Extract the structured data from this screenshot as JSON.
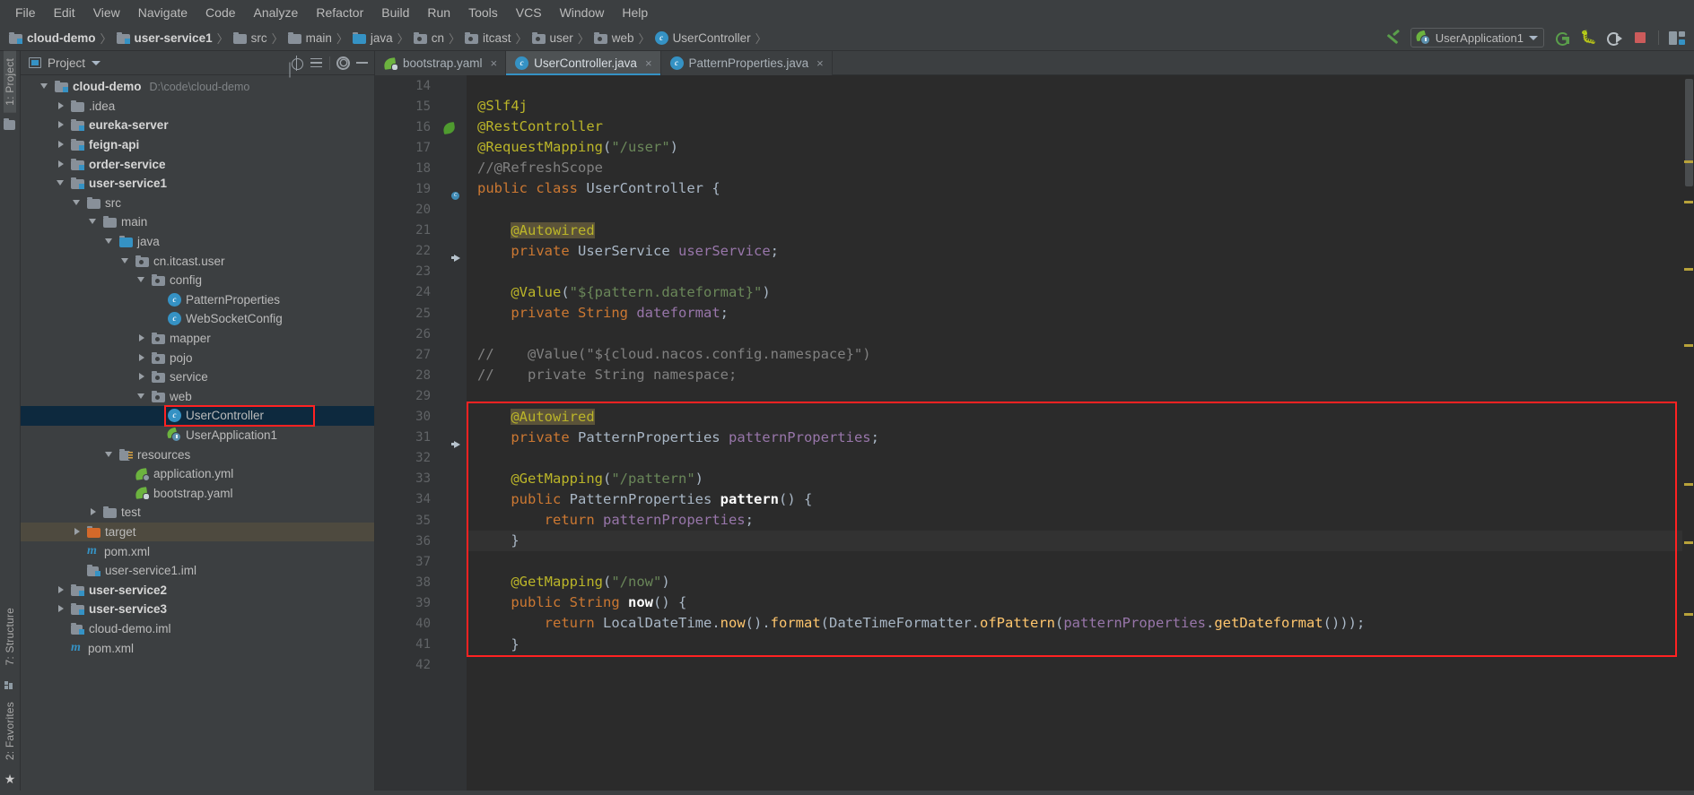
{
  "menubar": {
    "items": [
      "File",
      "Edit",
      "View",
      "Navigate",
      "Code",
      "Analyze",
      "Refactor",
      "Build",
      "Run",
      "Tools",
      "VCS",
      "Window",
      "Help"
    ]
  },
  "breadcrumb": {
    "items": [
      {
        "label": "cloud-demo",
        "icon": "module-icon",
        "bold": true
      },
      {
        "label": "user-service1",
        "icon": "module-icon",
        "bold": true
      },
      {
        "label": "src",
        "icon": "folder-icon",
        "bold": false
      },
      {
        "label": "main",
        "icon": "folder-icon",
        "bold": false
      },
      {
        "label": "java",
        "icon": "source-folder-icon",
        "bold": false
      },
      {
        "label": "cn",
        "icon": "package-icon",
        "bold": false
      },
      {
        "label": "itcast",
        "icon": "package-icon",
        "bold": false
      },
      {
        "label": "user",
        "icon": "package-icon",
        "bold": false
      },
      {
        "label": "web",
        "icon": "package-icon",
        "bold": false
      },
      {
        "label": "UserController",
        "icon": "class-icon",
        "bold": false
      }
    ],
    "separator": "〉"
  },
  "toolbar": {
    "build_icon": "hammer-icon",
    "run_config": "UserApplication1",
    "run_icon": "run-icon",
    "debug_icon": "debug-icon",
    "rerun_icon": "run-with-coverage-icon",
    "stop_icon": "stop-icon",
    "layout_icon": "layout-icon"
  },
  "leftstrip": {
    "project_tab": "1: Project",
    "structure_tab": "7: Structure",
    "favorites_tab": "2: Favorites"
  },
  "project_panel": {
    "title": "Project",
    "icons": [
      "scroll-from-source-icon",
      "collapse-all-icon",
      "gear-icon",
      "hide-icon"
    ],
    "tree": [
      {
        "depth": 0,
        "label": "cloud-demo",
        "path": "D:\\code\\cloud-demo",
        "icon": "module-icon",
        "twist": "down",
        "bold": true
      },
      {
        "depth": 1,
        "label": ".idea",
        "icon": "folder-icon",
        "twist": "right",
        "bold": false
      },
      {
        "depth": 1,
        "label": "eureka-server",
        "icon": "module-icon",
        "twist": "right",
        "bold": true
      },
      {
        "depth": 1,
        "label": "feign-api",
        "icon": "module-icon",
        "twist": "right",
        "bold": true
      },
      {
        "depth": 1,
        "label": "order-service",
        "icon": "module-icon",
        "twist": "right",
        "bold": true
      },
      {
        "depth": 1,
        "label": "user-service1",
        "icon": "module-icon",
        "twist": "down",
        "bold": true
      },
      {
        "depth": 2,
        "label": "src",
        "icon": "folder-icon",
        "twist": "down",
        "bold": false
      },
      {
        "depth": 3,
        "label": "main",
        "icon": "folder-icon",
        "twist": "down",
        "bold": false
      },
      {
        "depth": 4,
        "label": "java",
        "icon": "source-folder-icon",
        "twist": "down",
        "bold": false
      },
      {
        "depth": 5,
        "label": "cn.itcast.user",
        "icon": "package-icon",
        "twist": "down",
        "bold": false
      },
      {
        "depth": 6,
        "label": "config",
        "icon": "package-icon",
        "twist": "down",
        "bold": false
      },
      {
        "depth": 7,
        "label": "PatternProperties",
        "icon": "class-icon",
        "twist": "none",
        "bold": false
      },
      {
        "depth": 7,
        "label": "WebSocketConfig",
        "icon": "class-icon",
        "twist": "none",
        "bold": false
      },
      {
        "depth": 6,
        "label": "mapper",
        "icon": "package-icon",
        "twist": "right",
        "bold": false
      },
      {
        "depth": 6,
        "label": "pojo",
        "icon": "package-icon",
        "twist": "right",
        "bold": false
      },
      {
        "depth": 6,
        "label": "service",
        "icon": "package-icon",
        "twist": "right",
        "bold": false
      },
      {
        "depth": 6,
        "label": "web",
        "icon": "package-icon",
        "twist": "down",
        "bold": false
      },
      {
        "depth": 7,
        "label": "UserController",
        "icon": "class-icon",
        "twist": "none",
        "bold": false,
        "state": "selected",
        "annotated": true
      },
      {
        "depth": 7,
        "label": "UserApplication1",
        "icon": "spring-boot-icon",
        "twist": "none",
        "bold": false
      },
      {
        "depth": 4,
        "label": "resources",
        "icon": "resource-folder-icon",
        "twist": "down",
        "bold": false
      },
      {
        "depth": 5,
        "label": "application.yml",
        "icon": "spring-config-icon",
        "twist": "none",
        "bold": false
      },
      {
        "depth": 5,
        "label": "bootstrap.yaml",
        "icon": "spring-cloud-config-icon",
        "twist": "none",
        "bold": false
      },
      {
        "depth": 3,
        "label": "test",
        "icon": "folder-icon",
        "twist": "right",
        "bold": false
      },
      {
        "depth": 2,
        "label": "target",
        "icon": "target-folder-icon",
        "twist": "right",
        "bold": false,
        "state": "hover"
      },
      {
        "depth": 2,
        "label": "pom.xml",
        "icon": "maven-icon",
        "twist": "none",
        "bold": false
      },
      {
        "depth": 2,
        "label": "user-service1.iml",
        "icon": "iml-icon",
        "twist": "none",
        "bold": false
      },
      {
        "depth": 1,
        "label": "user-service2",
        "icon": "module-icon",
        "twist": "right",
        "bold": true
      },
      {
        "depth": 1,
        "label": "user-service3",
        "icon": "module-icon",
        "twist": "right",
        "bold": true
      },
      {
        "depth": 1,
        "label": "cloud-demo.iml",
        "icon": "iml-icon",
        "twist": "none",
        "bold": false
      },
      {
        "depth": 1,
        "label": "pom.xml",
        "icon": "maven-icon",
        "twist": "none",
        "bold": false
      }
    ]
  },
  "editor": {
    "tabs": [
      {
        "label": "bootstrap.yaml",
        "icon": "spring-cloud-config-icon",
        "active": false,
        "close": "×"
      },
      {
        "label": "UserController.java",
        "icon": "class-icon",
        "active": true,
        "close": "×"
      },
      {
        "label": "PatternProperties.java",
        "icon": "class-icon",
        "active": false,
        "close": "×"
      }
    ],
    "first_line_number": 14,
    "lines": [
      {
        "n": 14,
        "text": ""
      },
      {
        "n": 15,
        "text": "@Slf4j"
      },
      {
        "n": 16,
        "text": "@RestController"
      },
      {
        "n": 17,
        "text": "@RequestMapping(\"/user\")"
      },
      {
        "n": 18,
        "text": "//@RefreshScope"
      },
      {
        "n": 19,
        "text": "public class UserController {"
      },
      {
        "n": 20,
        "text": ""
      },
      {
        "n": 21,
        "text": "    @Autowired"
      },
      {
        "n": 22,
        "text": "    private UserService userService;"
      },
      {
        "n": 23,
        "text": ""
      },
      {
        "n": 24,
        "text": "    @Value(\"${pattern.dateformat}\")"
      },
      {
        "n": 25,
        "text": "    private String dateformat;"
      },
      {
        "n": 26,
        "text": ""
      },
      {
        "n": 27,
        "text": "//    @Value(\"${cloud.nacos.config.namespace}\")"
      },
      {
        "n": 28,
        "text": "//    private String namespace;"
      },
      {
        "n": 29,
        "text": ""
      },
      {
        "n": 30,
        "text": "    @Autowired"
      },
      {
        "n": 31,
        "text": "    private PatternProperties patternProperties;"
      },
      {
        "n": 32,
        "text": ""
      },
      {
        "n": 33,
        "text": "    @GetMapping(\"/pattern\")"
      },
      {
        "n": 34,
        "text": "    public PatternProperties pattern() {"
      },
      {
        "n": 35,
        "text": "        return patternProperties;"
      },
      {
        "n": 36,
        "text": "    }"
      },
      {
        "n": 37,
        "text": ""
      },
      {
        "n": 38,
        "text": "    @GetMapping(\"/now\")"
      },
      {
        "n": 39,
        "text": "    public String now() {"
      },
      {
        "n": 40,
        "text": "        return LocalDateTime.now().format(DateTimeFormatter.ofPattern(patternProperties.getDateformat()));"
      },
      {
        "n": 41,
        "text": "    }"
      },
      {
        "n": 42,
        "text": ""
      }
    ],
    "current_line": 36,
    "annotation_box": {
      "from_line": 30,
      "to_line": 41,
      "color": "#ff2222"
    }
  },
  "colors": {
    "accent": "#3592c4",
    "annotation_red": "#ff2222",
    "bg_editor": "#2b2b2b",
    "bg_panel": "#3c3f41",
    "selection": "#0d293e",
    "keyword": "#cc7832",
    "annotation": "#bbb529",
    "string": "#6a8759",
    "comment": "#808080",
    "field": "#9876aa",
    "method": "#ffc66d"
  }
}
